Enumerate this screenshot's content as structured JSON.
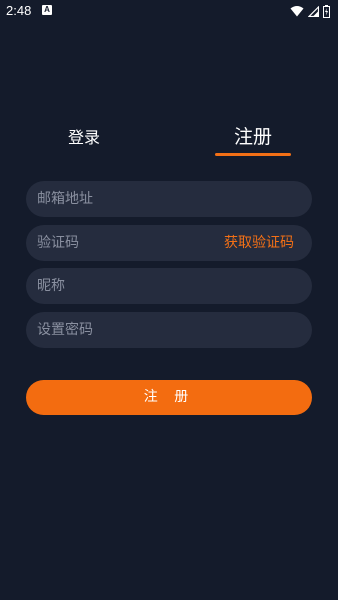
{
  "status_bar": {
    "time": "2:48",
    "notification_letter": "A",
    "icons": [
      "wifi-icon",
      "signal-icon",
      "battery-icon"
    ]
  },
  "tabs": {
    "login_label": "登录",
    "register_label": "注册",
    "active": "register"
  },
  "form": {
    "email_placeholder": "邮箱地址",
    "code_placeholder": "验证码",
    "get_code_label": "获取验证码",
    "nickname_placeholder": "昵称",
    "password_placeholder": "设置密码"
  },
  "register_button_label": "注 册",
  "colors": {
    "background": "#141b2b",
    "field": "#252c3e",
    "accent": "#f37016",
    "placeholder": "#8a90a0"
  }
}
